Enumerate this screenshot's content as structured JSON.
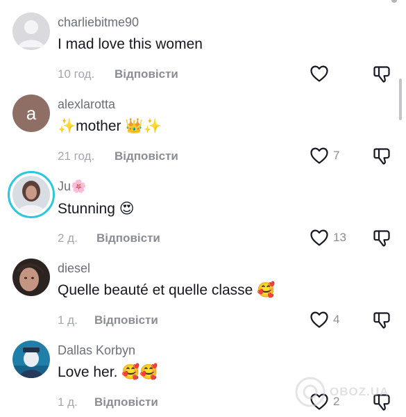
{
  "comments": [
    {
      "username": "charliebitme90",
      "text": "I mad love this women",
      "time": "10 год.",
      "reply": "Відповісти",
      "likes": "",
      "avatar": "default-avatar"
    },
    {
      "username": "alexlarotta",
      "text": "✨mother 👑✨",
      "time": "21 год.",
      "reply": "Відповісти",
      "likes": "7",
      "avatar": "letter-avatar",
      "avatar_letter": "a"
    },
    {
      "username": "Ju🌸",
      "text": "Stunning 😍",
      "time": "2 д.",
      "reply": "Відповісти",
      "likes": "13",
      "avatar": "photo-avatar"
    },
    {
      "username": "diesel",
      "text": "Quelle beauté et quelle classe 🥰",
      "time": "1 д.",
      "reply": "Відповісти",
      "likes": "4",
      "avatar": "photo-avatar"
    },
    {
      "username": "Dallas Korbyn",
      "text": "Love her. 🥰🥰",
      "time": "1 д.",
      "reply": "Відповісти",
      "likes": "2",
      "avatar": "photo-avatar"
    }
  ],
  "watermark": "OBOZ.UA",
  "colors": {
    "story_ring": "#29c7e0",
    "secondary_text": "#8a8d94"
  }
}
